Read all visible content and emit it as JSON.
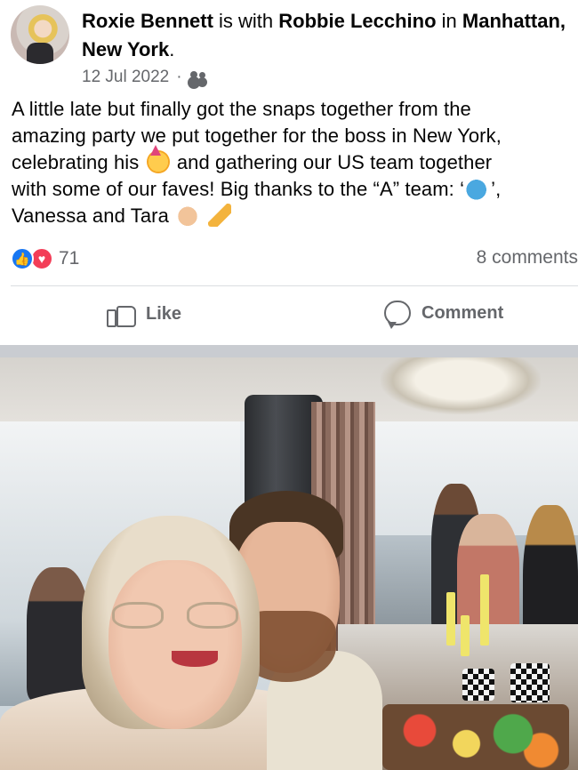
{
  "post": {
    "author": "Roxie Bennett",
    "connector": " is with ",
    "tagged": "Robbie Lecchino",
    "location_connector": " in ",
    "location": "Manhattan, New York",
    "location_end": ".",
    "date": "12 Jul 2022",
    "date_separator": "·",
    "privacy_icon": "friends-icon",
    "text": {
      "line1": "A little late but finally got the snaps together from the",
      "line2": "amazing party we put together for the boss in New York,",
      "line3_a": "celebrating his",
      "line3_b": "and gathering our US team together",
      "line4_a": "with some of our faves! Big thanks to the “A” team: ‘",
      "line4_b": "’,",
      "line5_a": "Vanessa and Tara"
    },
    "emojis": [
      "party-face-emoji",
      "whale-emoji",
      "clapping-hands-emoji",
      "party-popper-emoji"
    ]
  },
  "reactions": {
    "count": "71",
    "icons": [
      "like-reaction-icon",
      "love-reaction-icon"
    ],
    "comments": "8 comments"
  },
  "actions": {
    "like_label": "Like",
    "comment_label": "Comment"
  },
  "colors": {
    "like_blue": "#1877f2",
    "love_red": "#f33e58",
    "secondary_text": "#65676b",
    "separator": "#c9ccd1"
  }
}
